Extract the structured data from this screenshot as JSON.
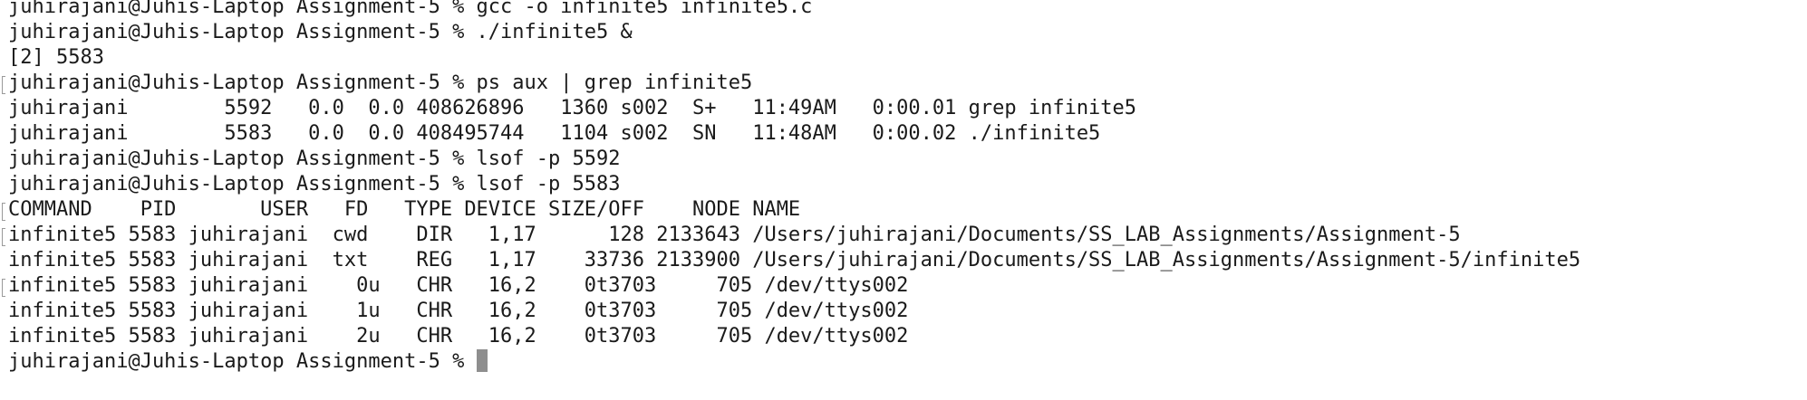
{
  "terminal": {
    "lines": [
      {
        "text": "juhirajani@Juhis-Laptop Assignment-5 % gcc -o infinite5 infinite5.c",
        "marked": false
      },
      {
        "text": "juhirajani@Juhis-Laptop Assignment-5 % ./infinite5 &",
        "marked": false
      },
      {
        "text": "[2] 5583",
        "marked": false
      },
      {
        "text": "juhirajani@Juhis-Laptop Assignment-5 % ps aux | grep infinite5",
        "marked": true
      },
      {
        "text": "juhirajani        5592   0.0  0.0 408626896   1360 s002  S+   11:49AM   0:00.01 grep infinite5",
        "marked": false
      },
      {
        "text": "juhirajani        5583   0.0  0.0 408495744   1104 s002  SN   11:48AM   0:00.02 ./infinite5",
        "marked": false
      },
      {
        "text": "juhirajani@Juhis-Laptop Assignment-5 % lsof -p 5592",
        "marked": false
      },
      {
        "text": "juhirajani@Juhis-Laptop Assignment-5 % lsof -p 5583",
        "marked": false
      },
      {
        "text": "COMMAND    PID       USER   FD   TYPE DEVICE SIZE/OFF    NODE NAME",
        "marked": true
      },
      {
        "text": "infinite5 5583 juhirajani  cwd    DIR   1,17      128 2133643 /Users/juhirajani/Documents/SS_LAB_Assignments/Assignment-5",
        "marked": true
      },
      {
        "text": "infinite5 5583 juhirajani  txt    REG   1,17    33736 2133900 /Users/juhirajani/Documents/SS_LAB_Assignments/Assignment-5/infinite5",
        "marked": false
      },
      {
        "text": "infinite5 5583 juhirajani    0u   CHR   16,2    0t3703     705 /dev/ttys002",
        "marked": true
      },
      {
        "text": "infinite5 5583 juhirajani    1u   CHR   16,2    0t3703     705 /dev/ttys002",
        "marked": false
      },
      {
        "text": "infinite5 5583 juhirajani    2u   CHR   16,2    0t3703     705 /dev/ttys002",
        "marked": false
      }
    ],
    "prompt": "juhirajani@Juhis-Laptop Assignment-5 % "
  }
}
